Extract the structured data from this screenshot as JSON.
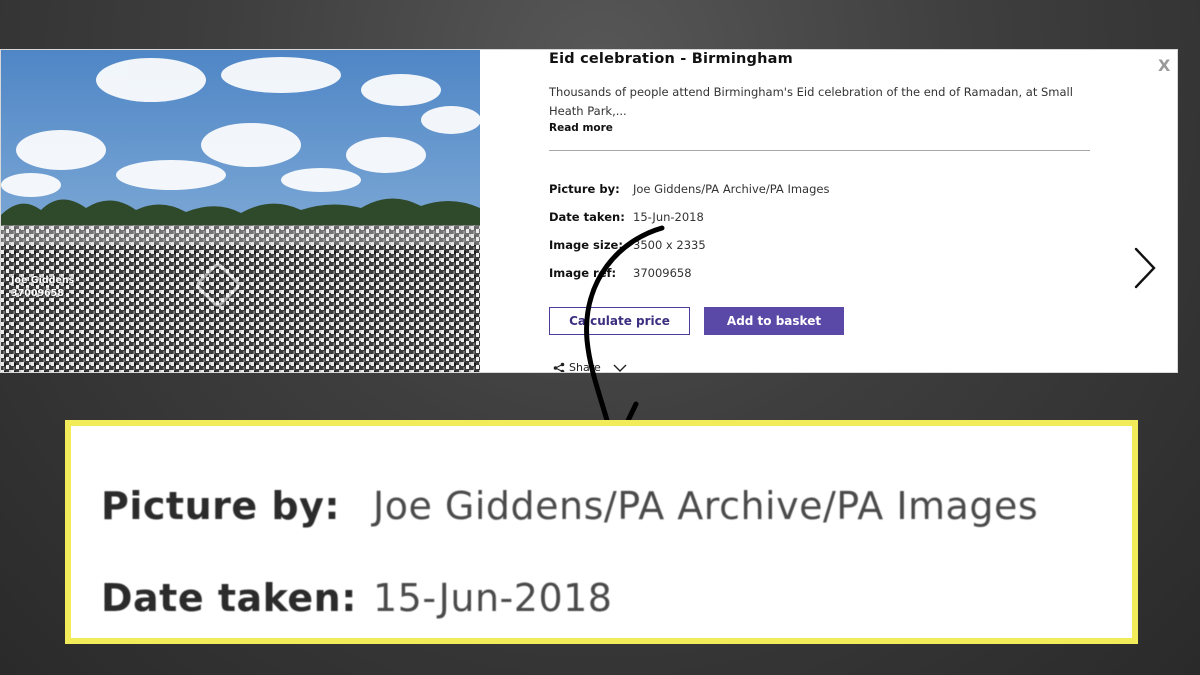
{
  "panel": {
    "photo": {
      "credit_name": "Joe Giddens",
      "credit_ref": "37009658"
    },
    "title": "Eid celebration - Birmingham",
    "close_label": "X",
    "description": "Thousands of people attend Birmingham's Eid celebration of the end of Ramadan, at Small Heath Park,...",
    "read_more": "Read more",
    "meta": [
      {
        "label": "Picture by:",
        "value": "Joe Giddens/PA Archive/PA Images"
      },
      {
        "label": "Date taken:",
        "value": "15-Jun-2018"
      },
      {
        "label": "Image size:",
        "value": "3500 x 2335"
      },
      {
        "label": "Image ref:",
        "value": "37009658"
      }
    ],
    "buttons": {
      "calculate": "Calculate price",
      "basket": "Add to basket"
    },
    "share_label": "Share",
    "colors": {
      "accent": "#5b49a8",
      "callout_border": "#f3ec5a"
    }
  },
  "callout": {
    "rows": [
      {
        "label": "Picture by:",
        "value": "Joe Giddens/PA Archive/PA Images"
      },
      {
        "label": "Date taken:",
        "value": "15-Jun-2018"
      }
    ]
  }
}
